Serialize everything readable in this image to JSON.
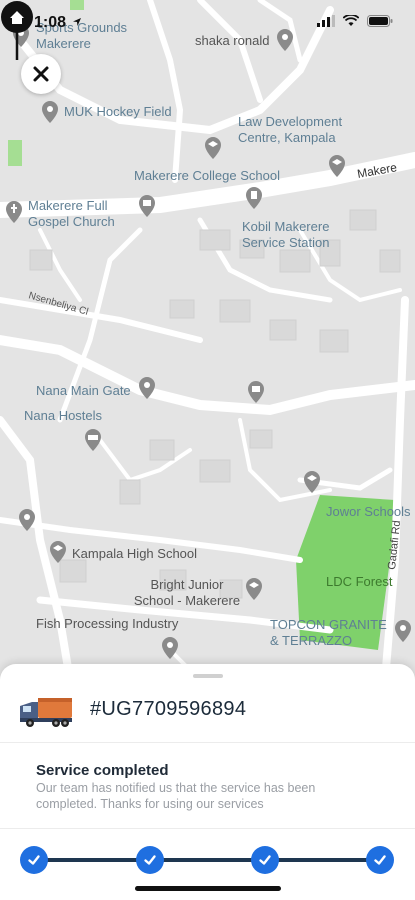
{
  "status_bar": {
    "time": "1:08"
  },
  "map": {
    "pois": [
      {
        "label": "Sports Grounds Makerere",
        "icon": "map-pin-icon"
      },
      {
        "label": "shaka ronald",
        "icon": "map-pin-icon"
      },
      {
        "label": "MUK Hockey Field",
        "icon": "map-pin-icon"
      },
      {
        "label": "Law Development Centre, Kampala",
        "icon": "school-icon"
      },
      {
        "label": "Makerere College School",
        "icon": "school-icon"
      },
      {
        "label": "Makerere Full Gospel Church",
        "icon": "church-icon"
      },
      {
        "label": "Kobil Makerere Service Station",
        "icon": "fuel-station-icon"
      },
      {
        "label": "Nsenbeliya Cl",
        "icon": ""
      },
      {
        "label": "Nana Main Gate",
        "icon": "map-pin-icon"
      },
      {
        "label": "Nana Hostels",
        "icon": "hotel-icon"
      },
      {
        "label": "Jowor Schools",
        "icon": "school-icon"
      },
      {
        "label": "Kampala High School",
        "icon": "school-icon"
      },
      {
        "label": "Bright Junior School - Makerere",
        "icon": "school-icon"
      },
      {
        "label": "LDC Forest",
        "icon": ""
      },
      {
        "label": "Fish Processing Industry",
        "icon": "map-pin-icon"
      },
      {
        "label": "TOPCON GRANITE & TERRAZZO",
        "icon": "map-pin-icon"
      },
      {
        "label": "Gadafi Rd",
        "icon": ""
      },
      {
        "label": "Makere",
        "icon": ""
      }
    ]
  },
  "sheet": {
    "tracking_number": "#UG7709596894",
    "status_title": "Service completed",
    "status_description": "Our team has notified us that the service has been completed. Thanks for using our services",
    "progress_steps_completed": 4,
    "progress_steps_total": 4
  },
  "colors": {
    "accent": "#1f6fe0",
    "progress_track": "#1e3650",
    "park_green": "#7fd16b",
    "poi_label": "#5f7f94"
  }
}
